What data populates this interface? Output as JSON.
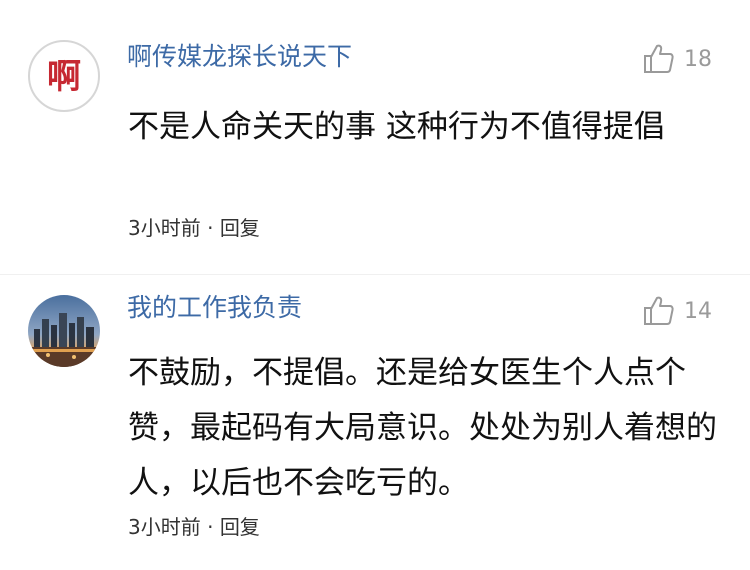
{
  "comments": [
    {
      "username": "啊传媒龙探长说天下",
      "avatar_text": "啊",
      "avatar_icon": "logo-avatar-icon",
      "likes": "18",
      "content": "不是人命关天的事 这种行为不值得提倡",
      "time": "3小时前",
      "separator": "·",
      "reply_label": "回复"
    },
    {
      "username": "我的工作我负责",
      "avatar_icon": "city-skyline-avatar-icon",
      "likes": "14",
      "content": "不鼓励，不提倡。还是给女医生个人点个赞，最起码有大局意识。处处为别人着想的人，以后也不会吃亏的。",
      "time": "3小时前",
      "separator": "·",
      "reply_label": "回复"
    }
  ],
  "colors": {
    "username": "#3d6aa6",
    "content": "#111111",
    "meta": "#333333",
    "likes": "#9a9a9a",
    "logo_red": "#c62832"
  }
}
